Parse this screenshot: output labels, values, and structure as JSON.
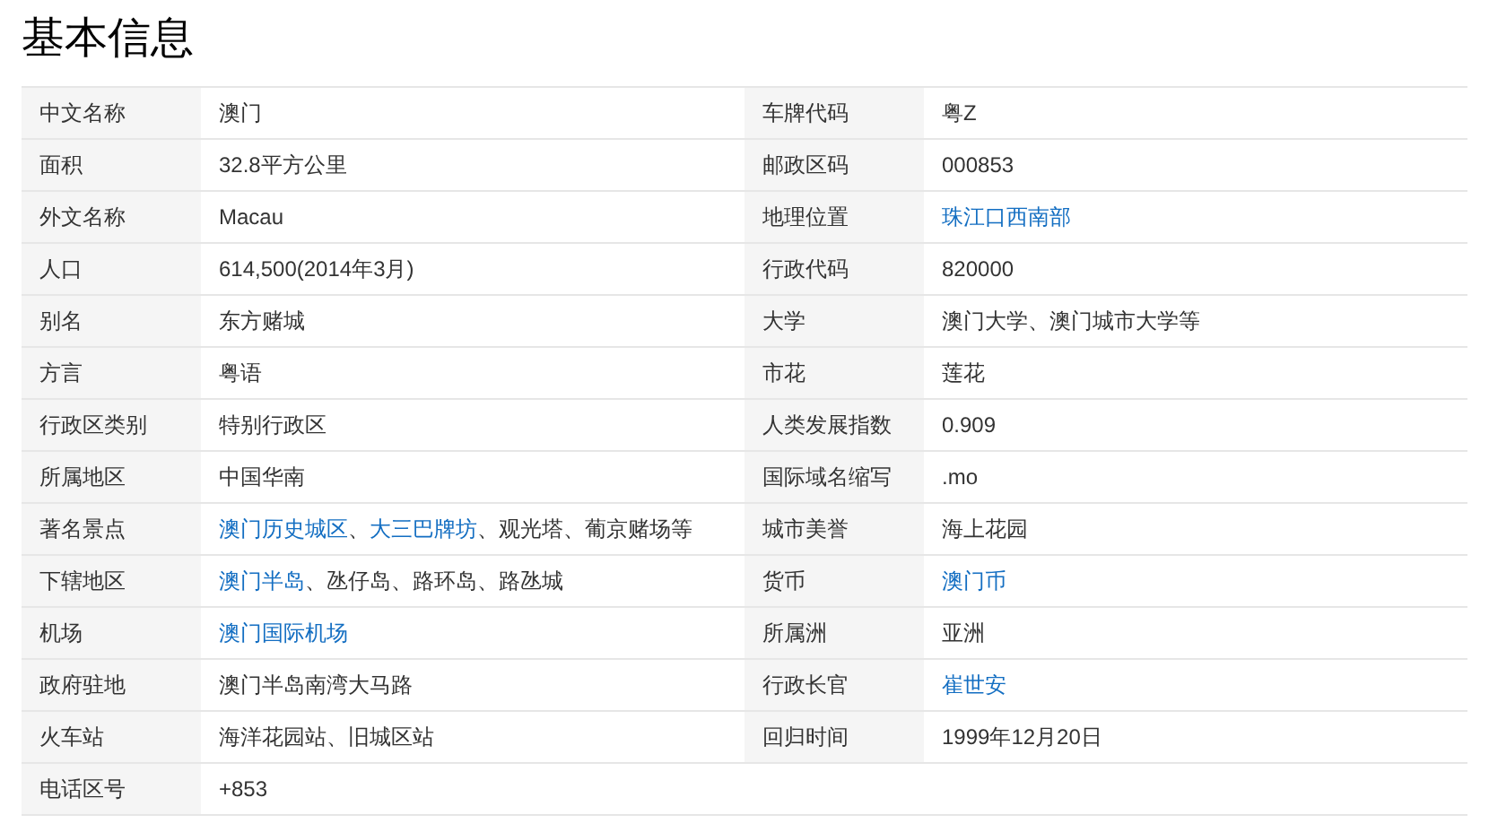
{
  "title": "基本信息",
  "rows": [
    {
      "left": {
        "label": "中文名称",
        "value": [
          {
            "text": "澳门",
            "link": false
          }
        ]
      },
      "right": {
        "label": "车牌代码",
        "value": [
          {
            "text": "粤Z",
            "link": false
          }
        ]
      }
    },
    {
      "left": {
        "label": "面积",
        "value": [
          {
            "text": "32.8平方公里",
            "link": false
          }
        ]
      },
      "right": {
        "label": "邮政区码",
        "value": [
          {
            "text": "000853",
            "link": false
          }
        ]
      }
    },
    {
      "left": {
        "label": "外文名称",
        "value": [
          {
            "text": "Macau",
            "link": false
          }
        ]
      },
      "right": {
        "label": "地理位置",
        "value": [
          {
            "text": "珠江口西南部",
            "link": true
          }
        ]
      }
    },
    {
      "left": {
        "label": "人口",
        "value": [
          {
            "text": "614,500(2014年3月)",
            "link": false
          }
        ]
      },
      "right": {
        "label": "行政代码",
        "value": [
          {
            "text": "820000",
            "link": false
          }
        ]
      }
    },
    {
      "left": {
        "label": "别名",
        "value": [
          {
            "text": "东方赌城",
            "link": false
          }
        ]
      },
      "right": {
        "label": "大学",
        "value": [
          {
            "text": "澳门大学、澳门城市大学等",
            "link": false
          }
        ]
      }
    },
    {
      "left": {
        "label": "方言",
        "value": [
          {
            "text": "粤语",
            "link": false
          }
        ]
      },
      "right": {
        "label": "市花",
        "value": [
          {
            "text": "莲花",
            "link": false
          }
        ]
      }
    },
    {
      "left": {
        "label": "行政区类别",
        "value": [
          {
            "text": "特别行政区",
            "link": false
          }
        ]
      },
      "right": {
        "label": "人类发展指数",
        "value": [
          {
            "text": "0.909",
            "link": false
          }
        ]
      }
    },
    {
      "left": {
        "label": "所属地区",
        "value": [
          {
            "text": "中国华南",
            "link": false
          }
        ]
      },
      "right": {
        "label": "国际域名缩写",
        "value": [
          {
            "text": ".mo",
            "link": false
          }
        ]
      }
    },
    {
      "left": {
        "label": "著名景点",
        "value": [
          {
            "text": "澳门历史城区",
            "link": true
          },
          {
            "text": "、",
            "link": false
          },
          {
            "text": "大三巴牌坊",
            "link": true
          },
          {
            "text": "、观光塔、葡京赌场等",
            "link": false
          }
        ]
      },
      "right": {
        "label": "城市美誉",
        "value": [
          {
            "text": "海上花园",
            "link": false
          }
        ]
      }
    },
    {
      "left": {
        "label": "下辖地区",
        "value": [
          {
            "text": "澳门半岛",
            "link": true
          },
          {
            "text": "、氹仔岛、路环岛、路氹城",
            "link": false
          }
        ]
      },
      "right": {
        "label": "货币",
        "value": [
          {
            "text": "澳门币",
            "link": true
          }
        ]
      }
    },
    {
      "left": {
        "label": "机场",
        "value": [
          {
            "text": "澳门国际机场",
            "link": true
          }
        ]
      },
      "right": {
        "label": "所属洲",
        "value": [
          {
            "text": "亚洲",
            "link": false
          }
        ]
      }
    },
    {
      "left": {
        "label": "政府驻地",
        "value": [
          {
            "text": "澳门半岛南湾大马路",
            "link": false
          }
        ]
      },
      "right": {
        "label": "行政长官",
        "value": [
          {
            "text": "崔世安",
            "link": true
          }
        ]
      }
    },
    {
      "left": {
        "label": "火车站",
        "value": [
          {
            "text": "海洋花园站、旧城区站",
            "link": false
          }
        ]
      },
      "right": {
        "label": "回归时间",
        "value": [
          {
            "text": "1999年12月20日",
            "link": false
          }
        ]
      }
    },
    {
      "left": {
        "label": "电话区号",
        "value": [
          {
            "text": "+853",
            "link": false
          }
        ]
      }
    }
  ]
}
